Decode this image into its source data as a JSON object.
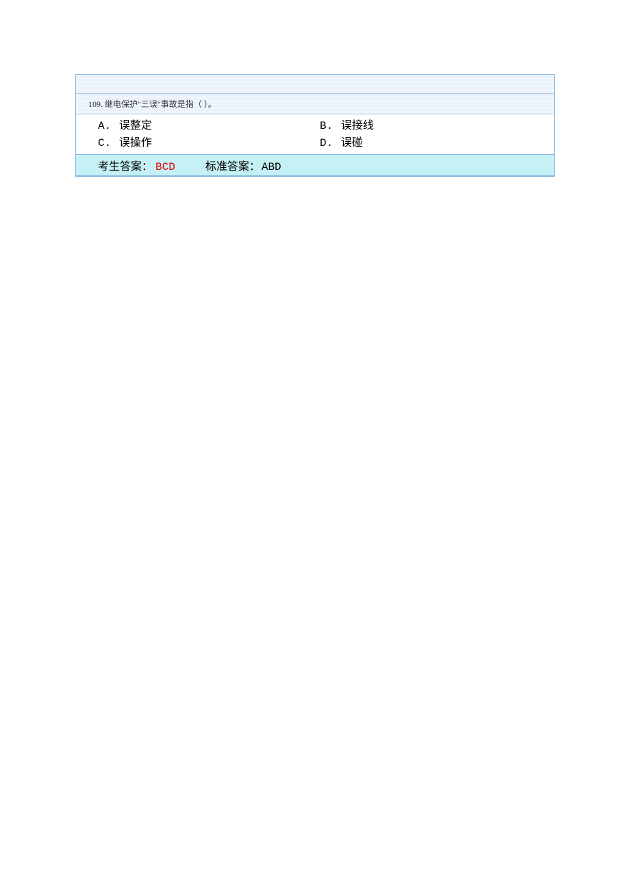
{
  "question": {
    "number": "109.",
    "text": "继电保护\"三误\"事故是指（ ）。",
    "options": [
      {
        "letter": "A.",
        "text": "误整定"
      },
      {
        "letter": "B.",
        "text": "误接线"
      },
      {
        "letter": "C.",
        "text": "误操作"
      },
      {
        "letter": "D.",
        "text": "误碰"
      }
    ],
    "user_answer_label": "考生答案：",
    "user_answer": "BCD",
    "standard_answer_label": "标准答案：",
    "standard_answer": "ABD"
  }
}
